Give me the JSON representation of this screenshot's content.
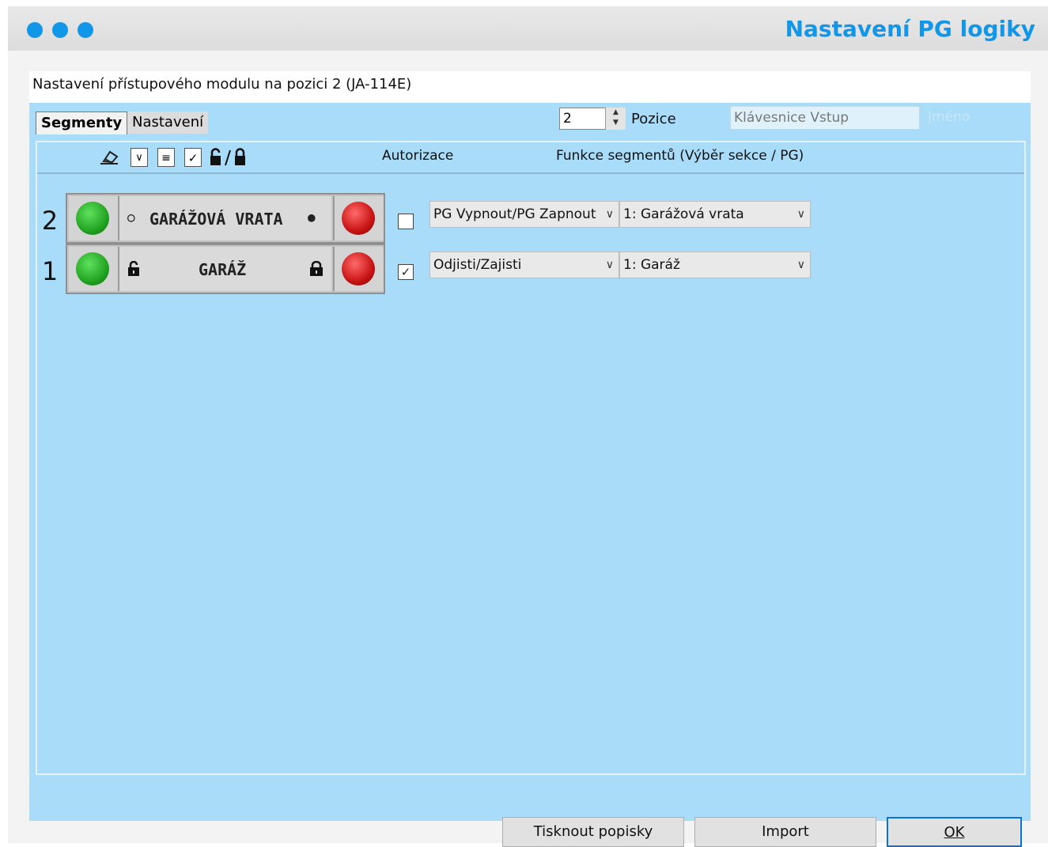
{
  "window": {
    "title": "Nastavení PG logiky"
  },
  "dialog": {
    "caption": "Nastavení přístupového modulu na pozici 2 (JA-114E)",
    "tabs": [
      {
        "label": "Segmenty"
      },
      {
        "label": "Nastavení"
      }
    ],
    "position": {
      "value": "2",
      "label": "Pozice"
    },
    "name": {
      "value": "Klávesnice Vstup",
      "label": "Jméno"
    },
    "columns": {
      "authorization": "Autorizace",
      "functions": "Funkce segmentů (Výběr sekce / PG)"
    },
    "segments": [
      {
        "number": "2",
        "label": "GARÁŽOVÁ VRATA",
        "left_symbol": "○",
        "right_symbol": "●",
        "checked": false,
        "function": "PG Vypnout/PG Zapnout",
        "target": "1: Garážová vrata"
      },
      {
        "number": "1",
        "label": "GARÁŽ",
        "left_symbol": "unlocked-padlock",
        "right_symbol": "locked-padlock",
        "checked": true,
        "function": "Odjisti/Zajisti",
        "target": "1: Garáž"
      }
    ],
    "buttons": {
      "print": "Tisknout popisky",
      "import": "Import",
      "ok": "OK"
    }
  },
  "colors": {
    "accent": "#1196e8",
    "panel": "#a9dcf8",
    "led_green": "#1e9e1e",
    "led_red": "#c81414"
  }
}
